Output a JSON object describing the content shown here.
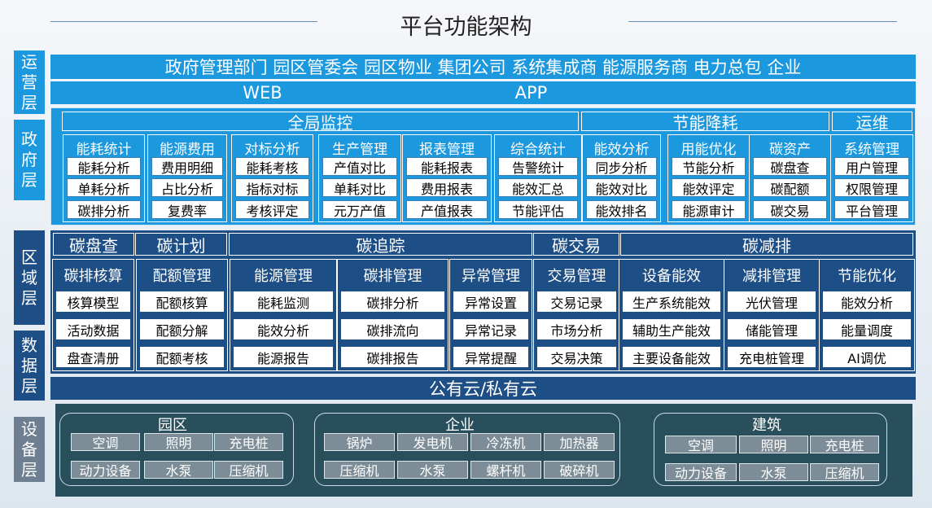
{
  "title": "平台功能架构",
  "side_labels": {
    "ops": [
      "运",
      "营",
      "层"
    ],
    "gov": [
      "政",
      "府",
      "层"
    ],
    "region": [
      "区",
      "域",
      "层"
    ],
    "data": [
      "数",
      "据",
      "层"
    ],
    "device": [
      "设",
      "备",
      "层"
    ]
  },
  "operators": "政府管理部门 园区管委会 园区物业 集团公司 系统集成商 能源服务商 电力总包 企业",
  "access": {
    "web": "WEB",
    "app": "APP"
  },
  "gov": {
    "headers": [
      "全局监控",
      "节能降耗",
      "运维"
    ],
    "modules": [
      {
        "name": "能耗统计",
        "items": [
          "能耗分析",
          "单耗分析",
          "碳排分析"
        ]
      },
      {
        "name": "能源费用",
        "items": [
          "费用明细",
          "占比分析",
          "复费率"
        ]
      },
      {
        "name": "对标分析",
        "items": [
          "能耗考核",
          "指标对标",
          "考核评定"
        ]
      },
      {
        "name": "生产管理",
        "items": [
          "产值对比",
          "单耗对比",
          "元万产值"
        ]
      },
      {
        "name": "报表管理",
        "items": [
          "能耗报表",
          "费用报表",
          "产值报表"
        ]
      },
      {
        "name": "综合统计",
        "items": [
          "告警统计",
          "能效汇总",
          "节能评估"
        ]
      },
      {
        "name": "能效分析",
        "items": [
          "同步分析",
          "能效对比",
          "能效排名"
        ]
      },
      {
        "name": "用能优化",
        "items": [
          "节能分析",
          "能效评定",
          "能源审计"
        ]
      },
      {
        "name": "碳资产",
        "items": [
          "碳盘查",
          "碳配额",
          "碳交易"
        ]
      },
      {
        "name": "系统管理",
        "items": [
          "用户管理",
          "权限管理",
          "平台管理"
        ]
      }
    ]
  },
  "region": {
    "headers": [
      "碳盘查",
      "碳计划",
      "碳追踪",
      "碳交易",
      "碳减排"
    ],
    "modules": [
      {
        "name": "碳排核算",
        "items": [
          "核算模型",
          "活动数据",
          "盘查清册"
        ]
      },
      {
        "name": "配额管理",
        "items": [
          "配额核算",
          "配额分解",
          "配额考核"
        ]
      },
      {
        "name": "能源管理",
        "items": [
          "能耗监测",
          "能效分析",
          "能源报告"
        ]
      },
      {
        "name": "碳排管理",
        "items": [
          "碳排分析",
          "碳排流向",
          "碳排报告"
        ]
      },
      {
        "name": "异常管理",
        "items": [
          "异常设置",
          "异常记录",
          "异常提醒"
        ]
      },
      {
        "name": "交易管理",
        "items": [
          "交易记录",
          "市场分析",
          "交易决策"
        ]
      },
      {
        "name": "设备能效",
        "items": [
          "生产系统能效",
          "辅助生产能效",
          "主要设备能效"
        ]
      },
      {
        "name": "减排管理",
        "items": [
          "光伏管理",
          "储能管理",
          "充电桩管理"
        ]
      },
      {
        "name": "节能优化",
        "items": [
          "能效分析",
          "能量调度",
          "AI调优"
        ]
      }
    ]
  },
  "cloud": "公有云/私有云",
  "devices": [
    {
      "name": "园区",
      "items": [
        "空调",
        "照明",
        "充电桩",
        "动力设备",
        "水泵",
        "压缩机"
      ]
    },
    {
      "name": "企业",
      "items": [
        "锅炉",
        "发电机",
        "冷冻机",
        "加热器",
        "压缩机",
        "水泵",
        "螺杆机",
        "破碎机"
      ]
    },
    {
      "name": "建筑",
      "items": [
        "空调",
        "照明",
        "充电桩",
        "动力设备",
        "水泵",
        "压缩机"
      ]
    }
  ]
}
